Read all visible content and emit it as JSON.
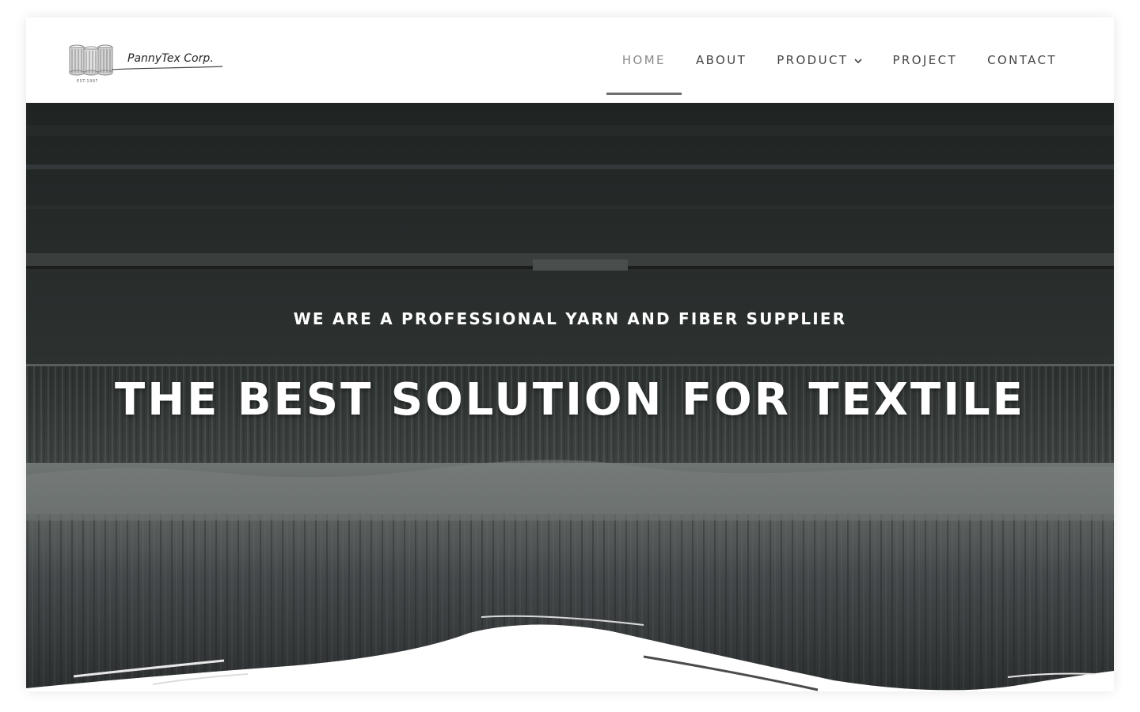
{
  "brand": {
    "name": "PannyTex Corp.",
    "established": "EST.1997",
    "logo_icon": "yarn-spools-icon"
  },
  "nav": {
    "items": [
      {
        "label": "HOME",
        "active": true
      },
      {
        "label": "ABOUT",
        "active": false
      },
      {
        "label": "PRODUCT",
        "active": false,
        "dropdown_icon": "chevron-down-icon"
      },
      {
        "label": "PROJECT",
        "active": false
      },
      {
        "label": "CONTACT",
        "active": false
      }
    ]
  },
  "hero": {
    "subtitle": "WE ARE A PROFESSIONAL YARN AND FIBER SUPPLIER",
    "title": "THE BEST SOLUTION FOR TEXTILE"
  },
  "colors": {
    "hero_dark": "#2b2e2d",
    "text_light": "#ffffff",
    "nav_text": "#444444",
    "nav_active": "#8a8a8a"
  }
}
